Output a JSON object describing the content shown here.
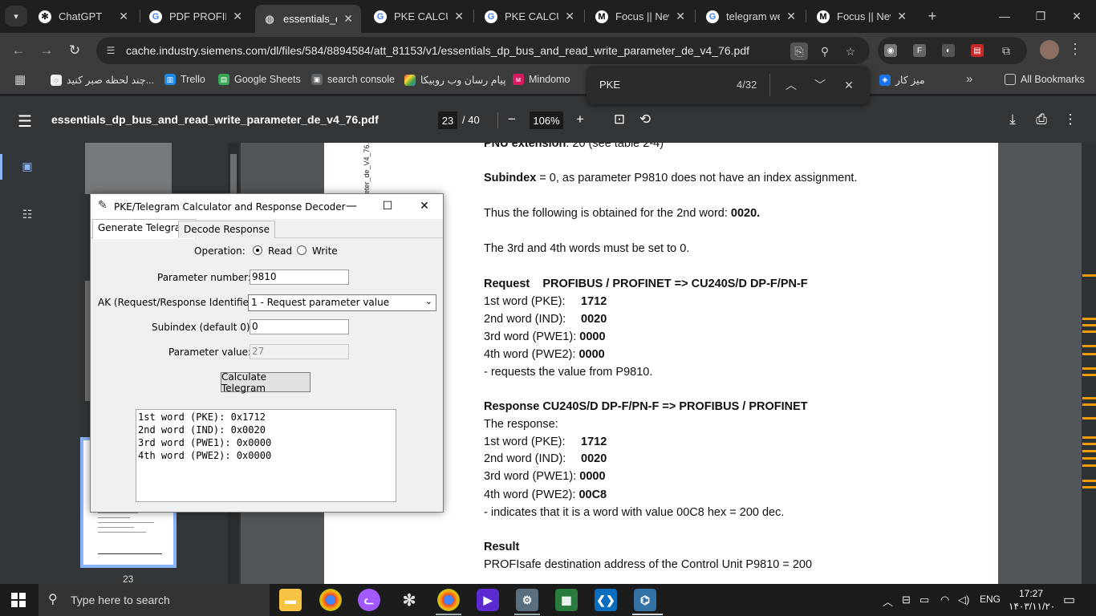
{
  "tabs": [
    {
      "title": "ChatGPT",
      "icon": "chatgpt-icon",
      "active": false
    },
    {
      "title": "PDF PROFIBU",
      "icon": "google-icon",
      "active": false
    },
    {
      "title": "essentials_dp",
      "icon": "globe-icon",
      "active": true
    },
    {
      "title": "PKE CALCUL",
      "icon": "google-icon",
      "active": false
    },
    {
      "title": "PKE CALCUL",
      "icon": "google-icon",
      "active": false
    },
    {
      "title": "Focus || New",
      "icon": "medium-icon",
      "active": false
    },
    {
      "title": "telegram we",
      "icon": "google-icon",
      "active": false
    },
    {
      "title": "Focus || New",
      "icon": "medium-icon",
      "active": false
    }
  ],
  "address": {
    "url": "cache.industry.siemens.com/dl/files/584/8894584/att_81153/v1/essentials_dp_bus_and_read_write_parameter_de_v4_76.pdf"
  },
  "bookmarks": [
    {
      "label": "چند لحظه صبر کنید...",
      "icon": "bookmark-icon"
    },
    {
      "label": "Trello",
      "icon": "trello-icon"
    },
    {
      "label": "Google Sheets",
      "icon": "sheets-icon"
    },
    {
      "label": "search console",
      "icon": "console-icon"
    },
    {
      "label": "پیام رسان وب روبیکا",
      "icon": "rubika-icon"
    },
    {
      "label": "Mindomo",
      "icon": "mindomo-icon"
    },
    {
      "label": "میز کار",
      "icon": "desk-icon"
    },
    {
      "label": "All Bookmarks",
      "icon": "folder-icon"
    }
  ],
  "findbar": {
    "query": "PKE",
    "count": "4/32"
  },
  "pdf": {
    "filename": "essentials_dp_bus_and_read_write_parameter_de_v4_76.pdf",
    "page": "23",
    "total": "/ 40",
    "zoom": "106%",
    "thumb_page_label": "23",
    "side_text": "eter_de_V4_76.d"
  },
  "page_lines": {
    "pno": {
      "label": "PNU extension",
      "text": ": 20 (see table 2-4)"
    },
    "subindex": {
      "label": "Subindex",
      "text": " = 0, as parameter P9810 does not have an index assignment."
    },
    "thus": {
      "text": "Thus the following is obtained for the 2nd word: ",
      "value": "0020."
    },
    "third": {
      "text": "The 3rd and 4th words must be set to 0."
    },
    "request_heading": "Request    PROFIBUS / PROFINET => CU240S/D DP-F/PN-F",
    "request_words": [
      {
        "label": "1st word (PKE):",
        "value": "1712"
      },
      {
        "label": "2nd word (IND):",
        "value": "0020"
      },
      {
        "label": "3rd word (PWE1):",
        "value": "0000"
      },
      {
        "label": "4th word (PWE2):",
        "value": "0000"
      }
    ],
    "request_note": "- requests the value from P9810.",
    "response_heading": "Response CU240S/D DP-F/PN-F => PROFIBUS / PROFINET",
    "response_intro": "The response:",
    "response_words": [
      {
        "label": "1st word (PKE):",
        "value": "1712"
      },
      {
        "label": "2nd word (IND):",
        "value": "0020"
      },
      {
        "label": "3rd word (PWE1):",
        "value": "0000"
      },
      {
        "label": "4th word (PWE2):",
        "value": "00C8"
      }
    ],
    "response_note": "- indicates that it is a word with value 00C8 hex = 200 dec.",
    "result_heading": "Result",
    "result_text": "PROFIsafe destination address of the Control Unit P9810 = 200"
  },
  "dialog": {
    "title": "PKE/Telegram Calculator and Response Decoder",
    "tab_generate": "Generate Telegram",
    "tab_decode": "Decode Response",
    "operation_label": "Operation:",
    "read_label": "Read",
    "write_label": "Write",
    "operation_selected": "Read",
    "param_number_label": "Parameter number:",
    "param_number_value": "9810",
    "ak_label": "AK (Request/Response Identifier):",
    "ak_value": "1 - Request parameter value",
    "subindex_label": "Subindex (default 0):",
    "subindex_value": "0",
    "param_value_label": "Parameter value:",
    "param_value_value": "27",
    "calc_button": "Calculate Telegram",
    "output": [
      "1st word (PKE): 0x1712",
      "2nd word (IND): 0x0020",
      "3rd word (PWE1): 0x0000",
      "4th word (PWE2): 0x0000"
    ]
  },
  "taskbar": {
    "search_placeholder": "Type here to search",
    "lang": "ENG",
    "time": "17:27",
    "date": "۱۴۰۳/۱۱/۲۰"
  },
  "colors": {
    "find_mark": "#f29900",
    "accent": "#8ab4f8"
  }
}
